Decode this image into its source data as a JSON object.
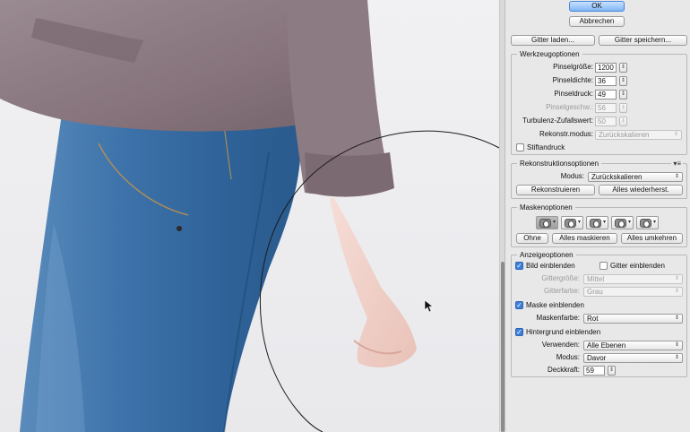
{
  "buttons": {
    "ok": "OK",
    "cancel": "Abbrechen",
    "load_mesh": "Gitter laden...",
    "save_mesh": "Gitter speichern..."
  },
  "tool_options": {
    "title": "Werkzeugoptionen",
    "brush_size_label": "Pinselgröße:",
    "brush_size": "1200",
    "brush_density_label": "Pinseldichte:",
    "brush_density": "36",
    "brush_pressure_label": "Pinseldruck:",
    "brush_pressure": "49",
    "brush_rate_label": "Pinselgeschw.:",
    "brush_rate": "56",
    "turbulent_jitter_label": "Turbulenz-Zufallswert:",
    "turbulent_jitter": "50",
    "reconstruct_mode_label": "Rekonstr.modus:",
    "reconstruct_mode": "Zurückskalieren",
    "stylus_pressure": "Stiftandruck"
  },
  "reconstruct_options": {
    "title": "Rekonstruktionsoptionen",
    "mode_label": "Modus:",
    "mode": "Zurückskalieren",
    "reconstruct_button": "Rekonstruieren",
    "restore_all_button": "Alles wiederherst."
  },
  "mask_options": {
    "title": "Maskenoptionen",
    "none_button": "Ohne",
    "mask_all_button": "Alles maskieren",
    "invert_all_button": "Alles umkehren"
  },
  "view_options": {
    "title": "Anzeigeoptionen",
    "show_image": "Bild einblenden",
    "show_mesh": "Gitter einblenden",
    "mesh_size_label": "Gittergröße:",
    "mesh_size": "Mittel",
    "mesh_color_label": "Gitterfarbe:",
    "mesh_color": "Grau",
    "show_mask": "Maske einblenden",
    "mask_color_label": "Maskenfarbe:",
    "mask_color": "Rot",
    "show_backdrop": "Hintergrund einblenden",
    "use_label": "Verwenden:",
    "use": "Alle Ebenen",
    "mode_label": "Modus:",
    "mode": "Davor",
    "opacity_label": "Deckkraft:",
    "opacity": "59"
  },
  "glyphs": {
    "stepper": "⇕",
    "arrow": "⇕",
    "check": "✓",
    "menu": "▾≡",
    "dropdown": "▾"
  },
  "colors": {
    "primary_button": "#7fb6f5",
    "checkbox_checked": "#3d7fd9",
    "shirt": "#8a7880",
    "jeans": "#3a6fa3"
  }
}
